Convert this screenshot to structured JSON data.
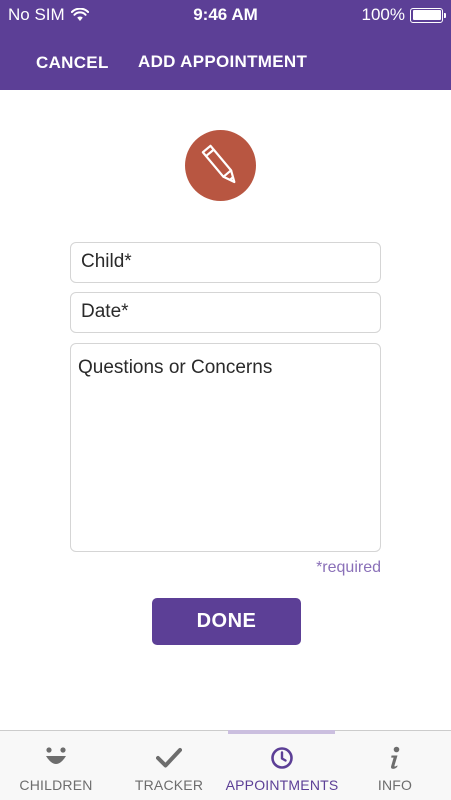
{
  "status_bar": {
    "carrier": "No SIM",
    "time": "9:46 AM",
    "battery": "100%",
    "battery_level": 1.0
  },
  "nav": {
    "cancel_label": "CANCEL",
    "title": "ADD APPOINTMENT"
  },
  "form": {
    "icon": "pencil-icon",
    "child_placeholder": "Child*",
    "date_placeholder": "Date*",
    "questions_placeholder": "Questions or Concerns",
    "required_note": "*required",
    "done_label": "DONE"
  },
  "tabs": [
    {
      "label": "CHILDREN",
      "icon": "smiley-face-icon",
      "active": false
    },
    {
      "label": "TRACKER",
      "icon": "checkmark-icon",
      "active": false
    },
    {
      "label": "APPOINTMENTS",
      "icon": "clock-icon",
      "active": true
    },
    {
      "label": "INFO",
      "icon": "info-icon",
      "active": false
    }
  ],
  "colors": {
    "brand_purple": "#5c3f96",
    "icon_circle": "#b85641",
    "required_text": "#8a70b8",
    "tab_inactive": "#6d6d6d"
  }
}
